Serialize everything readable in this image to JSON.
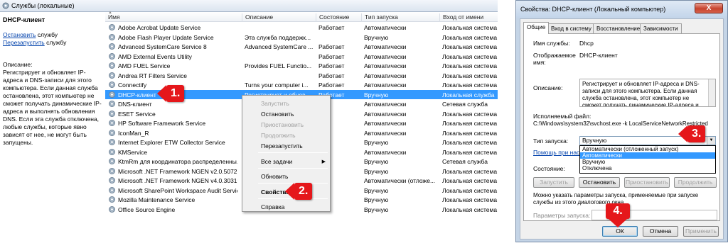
{
  "services_window": {
    "header_title": "Службы (локальные)",
    "left_panel": {
      "title": "DHCP-клиент",
      "stop_link": "Остановить",
      "stop_suffix": " службу",
      "restart_link": "Перезапустить",
      "restart_suffix": " службу",
      "description_label": "Описание:",
      "description_text": "Регистрирует и обновляет IP-адреса и DNS-записи для этого компьютера. Если данная служба остановлена, этот компьютер не сможет получать динамические IP-адреса и выполнять обновления DNS. Если эта служба отключена, любые службы, которые явно зависят от нее, не могут быть запущены."
    },
    "columns": [
      "Имя",
      "Описание",
      "Состояние",
      "Тип запуска",
      "Вход от имени"
    ],
    "rows": [
      {
        "name": "Adobe Acrobat Update Service",
        "desc": "",
        "state": "Работает",
        "start": "Автоматически",
        "logon": "Локальная система"
      },
      {
        "name": "Adobe Flash Player Update Service",
        "desc": "Эта служба поддержк...",
        "state": "",
        "start": "Вручную",
        "logon": "Локальная система"
      },
      {
        "name": "Advanced SystemCare Service 8",
        "desc": "Advanced SystemCare ...",
        "state": "Работает",
        "start": "Автоматически",
        "logon": "Локальная система"
      },
      {
        "name": "AMD External Events Utility",
        "desc": "",
        "state": "Работает",
        "start": "Автоматически",
        "logon": "Локальная система"
      },
      {
        "name": "AMD FUEL Service",
        "desc": "Provides FUEL Functio...",
        "state": "Работает",
        "start": "Автоматически",
        "logon": "Локальная система"
      },
      {
        "name": "Andrea RT Filters Service",
        "desc": "",
        "state": "Работает",
        "start": "Автоматически",
        "logon": "Локальная система"
      },
      {
        "name": "Connectify",
        "desc": "Turns your computer i...",
        "state": "Работает",
        "start": "Автоматически",
        "logon": "Локальная система"
      },
      {
        "name": "DHCP-клиент",
        "desc": "Регистрирует и обнов...",
        "state": "Работает",
        "start": "Вручную",
        "logon": "Локальная служба"
      },
      {
        "name": "DNS-клиент",
        "desc": "",
        "state": "",
        "start": "Автоматически",
        "logon": "Сетевая служба"
      },
      {
        "name": "ESET Service",
        "desc": "",
        "state": "",
        "start": "Автоматически",
        "logon": "Локальная система"
      },
      {
        "name": "HP Software Framework Service",
        "desc": "",
        "state": "",
        "start": "Автоматически",
        "logon": "Локальная система"
      },
      {
        "name": "IconMan_R",
        "desc": "",
        "state": "",
        "start": "Автоматически",
        "logon": "Локальная система"
      },
      {
        "name": "Internet Explorer ETW Collector Service",
        "desc": "",
        "state": "",
        "start": "Вручную",
        "logon": "Локальная система"
      },
      {
        "name": "KMService",
        "desc": "",
        "state": "",
        "start": "Автоматически",
        "logon": "Локальная система"
      },
      {
        "name": "KtmRm для координатора распределенны...",
        "desc": "",
        "state": "",
        "start": "Вручную",
        "logon": "Сетевая служба"
      },
      {
        "name": "Microsoft .NET Framework NGEN v2.0.50727...",
        "desc": "",
        "state": "",
        "start": "Вручную",
        "logon": "Локальная система"
      },
      {
        "name": "Microsoft .NET Framework NGEN v4.0.30319...",
        "desc": "",
        "state": "",
        "start": "Автоматически (отложе...",
        "logon": "Локальная система"
      },
      {
        "name": "Microsoft SharePoint Workspace Audit Service",
        "desc": "",
        "state": "",
        "start": "Вручную",
        "logon": "Локальная система"
      },
      {
        "name": "Mozilla Maintenance Service",
        "desc": "",
        "state": "",
        "start": "Вручную",
        "logon": "Локальная система"
      },
      {
        "name": "Office  Source Engine",
        "desc": "",
        "state": "",
        "start": "Вручную",
        "logon": "Локальная система"
      }
    ],
    "context_menu": {
      "start": "Запустить",
      "stop": "Остановить",
      "pause": "Приостановить",
      "resume": "Продолжить",
      "restart": "Перезапустить",
      "all_tasks": "Все задачи",
      "refresh": "Обновить",
      "properties": "Свойства",
      "help": "Справка"
    }
  },
  "badges": {
    "one": "1.",
    "two": "2.",
    "three": "3.",
    "four": "4."
  },
  "colors": {
    "selection": "#3399ff",
    "badge_red": "#e5171b"
  },
  "dialog": {
    "title": "Свойства: DHCP-клиент (Локальный компьютер)",
    "close": "X",
    "tabs": [
      "Общие",
      "Вход в систему",
      "Восстановление",
      "Зависимости"
    ],
    "service_name_label": "Имя службы:",
    "service_name": "Dhcp",
    "display_name_label": "Отображаемое имя:",
    "display_name": "DHCP-клиент",
    "description_label": "Описание:",
    "description": "Регистрирует и обновляет IP-адреса и DNS-записи для этого компьютера. Если данная служба остановлена, этот компьютер не сможет получать динамические IP-адреса и",
    "exe_label": "Исполняемый файл:",
    "exe_path": "C:\\Windows\\system32\\svchost.exe -k LocalServiceNetworkRestricted",
    "startup_label": "Тип запуска:",
    "startup_value": "Вручную",
    "startup_options": [
      "Автоматически (отложенный запуск)",
      "Автоматически",
      "Вручную",
      "Отключена"
    ],
    "startup_selected_index": 1,
    "help_link": "Помощь при наст",
    "state_label": "Состояние:",
    "btn_start": "Запустить",
    "btn_stop": "Остановить",
    "btn_pause": "Приостановить",
    "btn_resume": "Продолжить",
    "params_hint": "Можно указать параметры запуска, применяемые при запуске службы из этого диалогового окна.",
    "params_label": "Параметры запуска:",
    "params_value": "",
    "ok": "ОК",
    "cancel": "Отмена",
    "apply": "Применить"
  }
}
